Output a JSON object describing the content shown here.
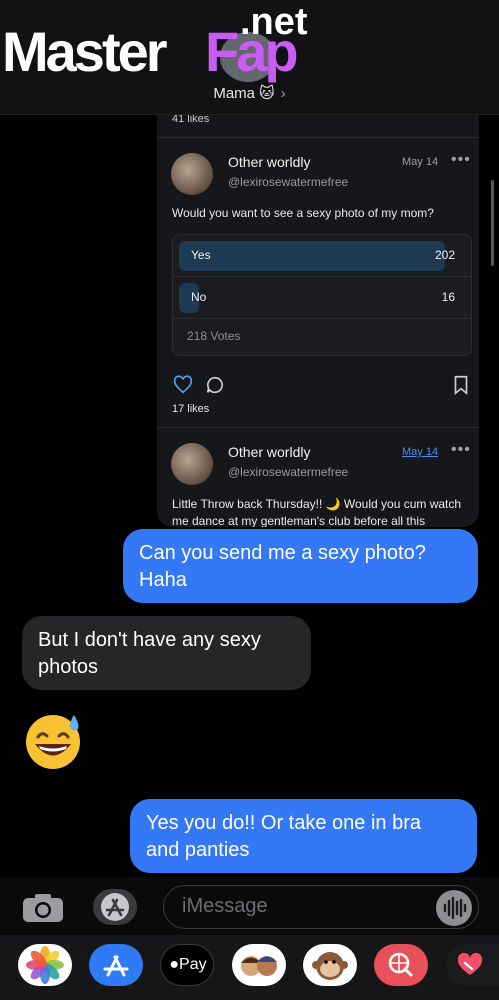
{
  "watermark": {
    "brand": "Master",
    "brand_accent": "Fap",
    "tld": ".net"
  },
  "header": {
    "contact_name": "Mama",
    "contact_emoji": "🐱",
    "chevron": "›"
  },
  "card": {
    "top_likes": "41 likes",
    "post1": {
      "author": "Other worldly",
      "handle": "@lexirosewatermefree",
      "date": "May 14",
      "more": "•••",
      "text": "Would you want to see a sexy photo of my mom?",
      "poll": {
        "options": [
          {
            "label": "Yes",
            "count": "202",
            "share": 0.93
          },
          {
            "label": "No",
            "count": "16",
            "share": 0.07
          }
        ],
        "votes": "218 Votes"
      },
      "likes": "17 likes"
    },
    "post2": {
      "author": "Other worldly",
      "handle": "@lexirosewatermefree",
      "date": "May 14",
      "more": "•••",
      "text_line1": "Little Throw back Thursday!! 🌙 Would you cum watch",
      "text_line2": "me dance at my gentleman's club before all this"
    }
  },
  "messages": [
    {
      "side": "sent",
      "line1": "Can you send me a sexy photo?",
      "line2": "Haha"
    },
    {
      "side": "received",
      "line1": "But I don't have any sexy",
      "line2": "photos"
    },
    {
      "side": "received",
      "emoji": "😅"
    },
    {
      "side": "sent",
      "line1": "Yes you do!! Or take one in bra",
      "line2": "and panties"
    }
  ],
  "input": {
    "placeholder": "iMessage"
  },
  "apps": {
    "pay_label": "Pay"
  },
  "colors": {
    "sent_bubble": "#3478f6",
    "received_bubble": "#262628",
    "accent_link": "#4b8ef0"
  }
}
